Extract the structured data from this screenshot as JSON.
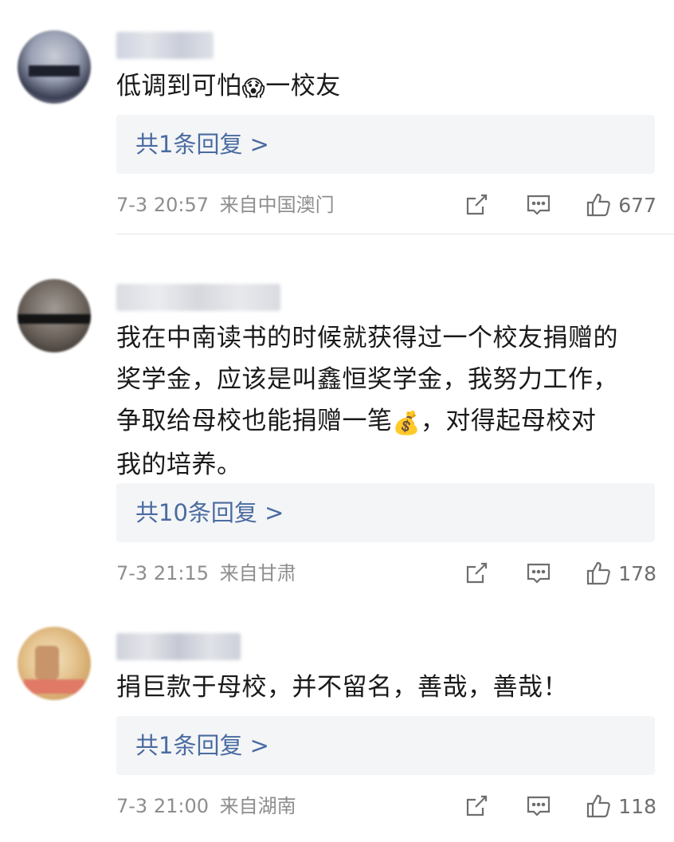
{
  "comments": [
    {
      "text_parts": [
        "低调到可怕",
        "😱",
        "一校友"
      ],
      "replies_label": "共1条回复 >",
      "timestamp": "7-3 20:57",
      "location": "来自中国澳门",
      "likes": "677"
    },
    {
      "text_lines": [
        "我在中南读书的时候就获得过一个校友捐赠的",
        "奖学金，应该是叫鑫恒奖学金，我努力工作，",
        "争取给母校也能捐赠一笔",
        "💰",
        "，对得起母校对",
        "我的培养。"
      ],
      "replies_label": "共10条回复 >",
      "timestamp": "7-3 21:15",
      "location": "来自甘肃",
      "likes": "178"
    },
    {
      "text": "捐巨款于母校，并不留名，善哉，善哉！",
      "replies_label": "共1条回复 >",
      "timestamp": "7-3 21:00",
      "location": "来自湖南",
      "likes": "118"
    }
  ],
  "icons": {
    "share": "share-icon",
    "comment": "comment-icon",
    "like": "thumbs-up-icon"
  },
  "colors": {
    "reply_link": "#4a6ba0",
    "meta_gray": "#8d8d8d",
    "reply_bg": "#f4f5f7"
  }
}
